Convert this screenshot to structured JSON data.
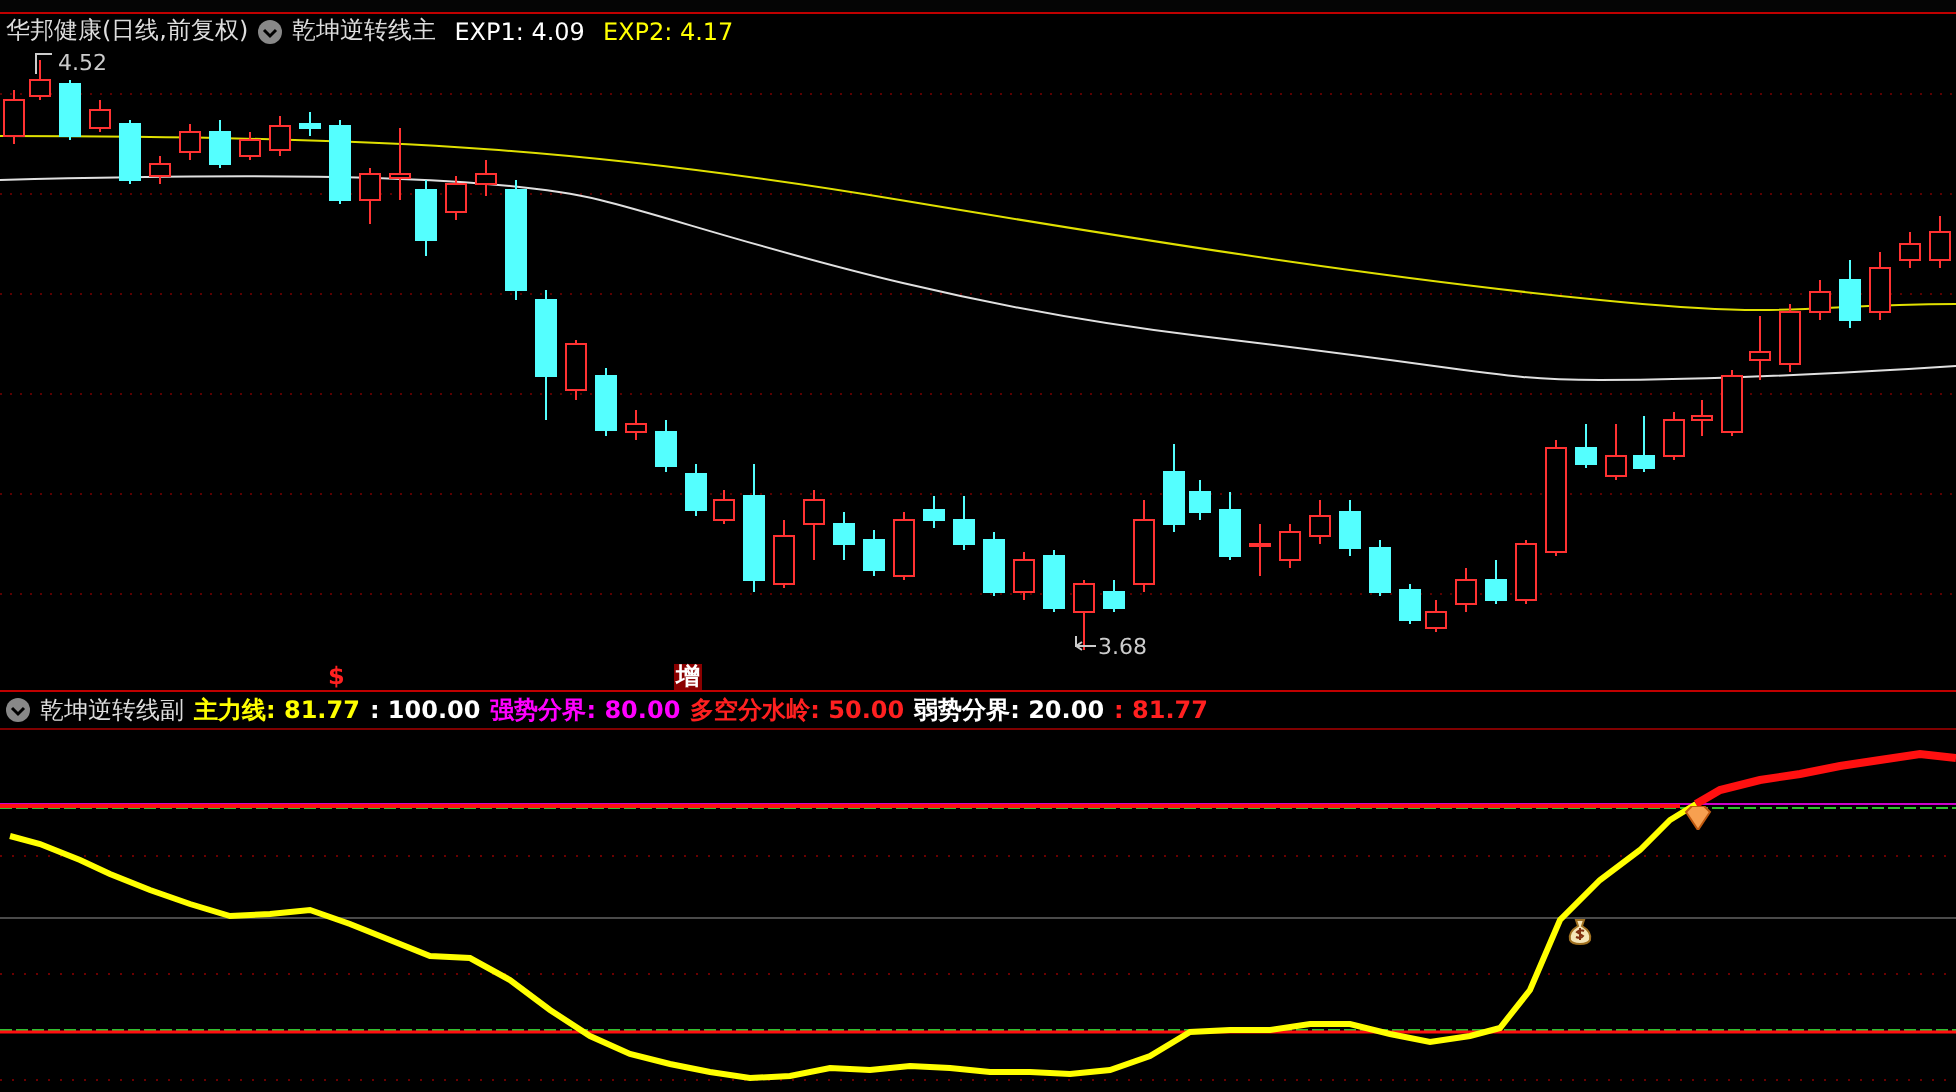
{
  "header": {
    "stock": "华邦健康(日线,前复权)",
    "indicator": "乾坤逆转线主",
    "readings": [
      {
        "text": "EXP1: 4.09",
        "color": "#ffffff"
      },
      {
        "text": "EXP2: 4.17",
        "color": "#ffff00"
      }
    ]
  },
  "price_labels": [
    {
      "text": "4.52",
      "kind": "high"
    },
    {
      "text": "3.68",
      "kind": "low"
    }
  ],
  "signals": [
    {
      "text": "$",
      "kind": "buy"
    },
    {
      "text": "增",
      "kind": "add"
    }
  ],
  "legend": {
    "indicator": "乾坤逆转线副",
    "items": [
      {
        "text": "主力线: 81.77",
        "color": "#ffff00"
      },
      {
        "text": ": 100.00",
        "color": "#ffffff"
      },
      {
        "text": "强势分界: 80.00",
        "color": "#ff00ff"
      },
      {
        "text": "多空分水岭: 50.00",
        "color": "#ff2020"
      },
      {
        "text": "弱势分界: 20.00",
        "color": "#ffffff"
      },
      {
        "text": ": 81.77",
        "color": "#ff2020"
      }
    ]
  }
}
